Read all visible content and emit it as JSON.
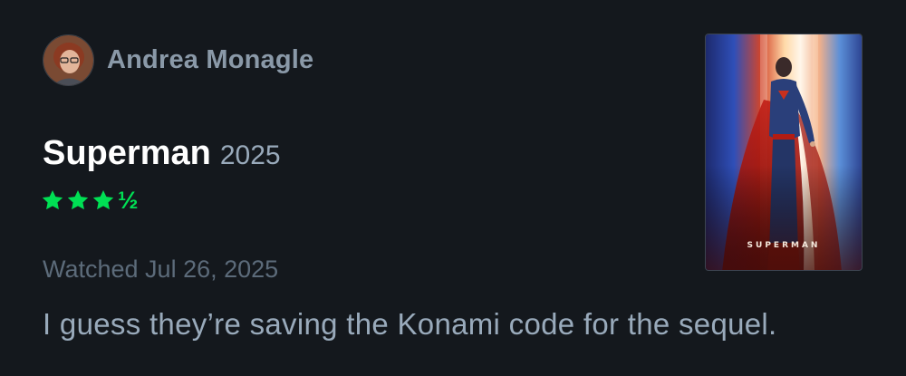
{
  "review": {
    "author_name": "Andrea Monagle",
    "film_title": "Superman",
    "film_year": "2025",
    "rating": {
      "value": 3.5,
      "max": 5,
      "half_glyph": "½",
      "star_color": "#00e054"
    },
    "watched_label": "Watched Jul 26, 2025",
    "text": "I guess they’re saving the Konami code for the sequel.",
    "poster_logo_text": "SUPERMAN"
  },
  "colors": {
    "background": "#14181d",
    "title": "#ffffff",
    "secondary_text": "#99aabb",
    "muted_text": "#5c6b7a"
  }
}
